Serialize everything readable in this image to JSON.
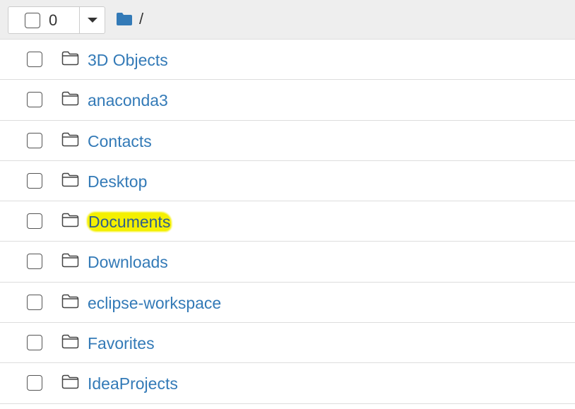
{
  "header": {
    "selected_count": "0",
    "path": "/"
  },
  "rows": [
    {
      "name": "3D Objects"
    },
    {
      "name": "anaconda3"
    },
    {
      "name": "Contacts"
    },
    {
      "name": "Desktop"
    },
    {
      "name": "Documents",
      "highlighted": true
    },
    {
      "name": "Downloads"
    },
    {
      "name": "eclipse-workspace"
    },
    {
      "name": "Favorites"
    },
    {
      "name": "IdeaProjects"
    }
  ],
  "icons": {
    "header_path": "folder-filled-icon",
    "row": "folder-outline-icon",
    "dropdown": "caret-down-icon"
  },
  "colors": {
    "link": "#337ab7",
    "folder_fill": "#337ab7",
    "highlight": "#f4f000",
    "header_bg": "#eeeeee"
  }
}
